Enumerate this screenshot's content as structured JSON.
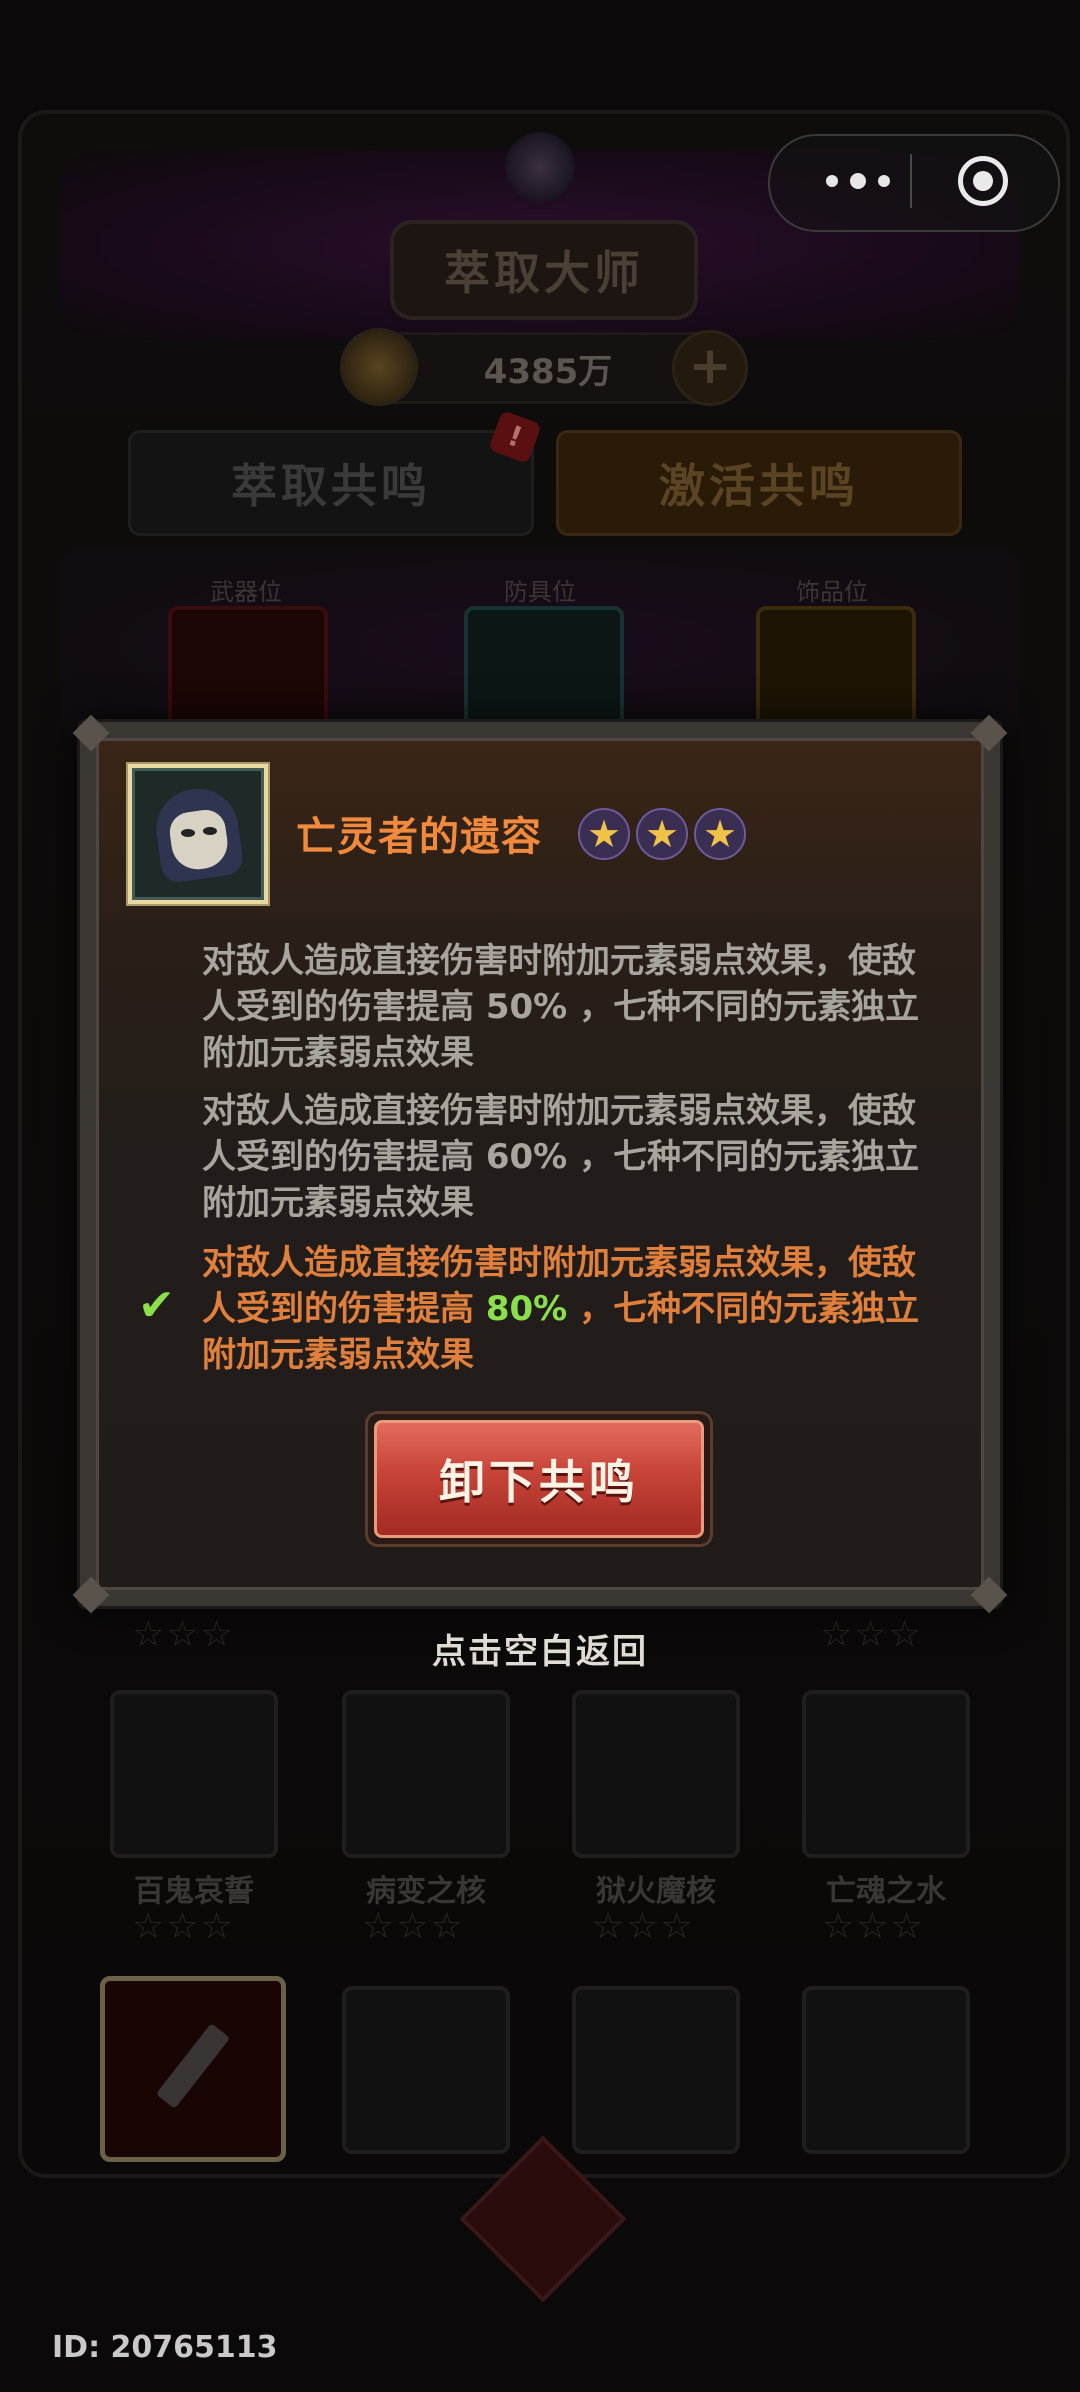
{
  "background": {
    "title": "萃取大师",
    "coins": "4385万",
    "tabs": [
      {
        "label": "萃取共鸣"
      },
      {
        "label": "激活共鸣"
      }
    ],
    "tab_badge": "!",
    "slots": [
      {
        "label": "武器位"
      },
      {
        "label": "防具位"
      },
      {
        "label": "饰品位"
      }
    ],
    "items_row": [
      {
        "name": "百鬼哀誓",
        "stars": "☆☆☆"
      },
      {
        "name": "病变之核",
        "stars": "☆☆☆"
      },
      {
        "name": "狱火魔核",
        "stars": "☆☆☆"
      },
      {
        "name": "亡魂之水",
        "stars": "☆☆☆"
      }
    ],
    "row_stars_above": "☆☆☆",
    "user_id": "ID: 20765113"
  },
  "modal": {
    "item_name": "亡灵者的遗容",
    "star_count": 3,
    "star_glyph": "★",
    "effects": [
      {
        "pre": "对敌人造成直接伤害时附加元素弱点效果，使敌人受到的伤害提高 ",
        "pct": "50%",
        "post": " ，七种不同的元素独立附加元素弱点效果",
        "active": false
      },
      {
        "pre": "对敌人造成直接伤害时附加元素弱点效果，使敌人受到的伤害提高 ",
        "pct": "60%",
        "post": " ，七种不同的元素独立附加元素弱点效果",
        "active": false
      },
      {
        "pre": "对敌人造成直接伤害时附加元素弱点效果，使敌人受到的伤害提高 ",
        "pct": "80%",
        "post": " ，七种不同的元素独立附加元素弱点效果",
        "active": true
      }
    ],
    "check_glyph": "✔",
    "unequip_label": "卸下共鸣",
    "dismiss_hint": "点击空白返回"
  },
  "colors": {
    "title_orange": "#f28a3e",
    "active_text": "#e0803c",
    "pct_green": "#8be04a",
    "button_red": "#c64337"
  }
}
